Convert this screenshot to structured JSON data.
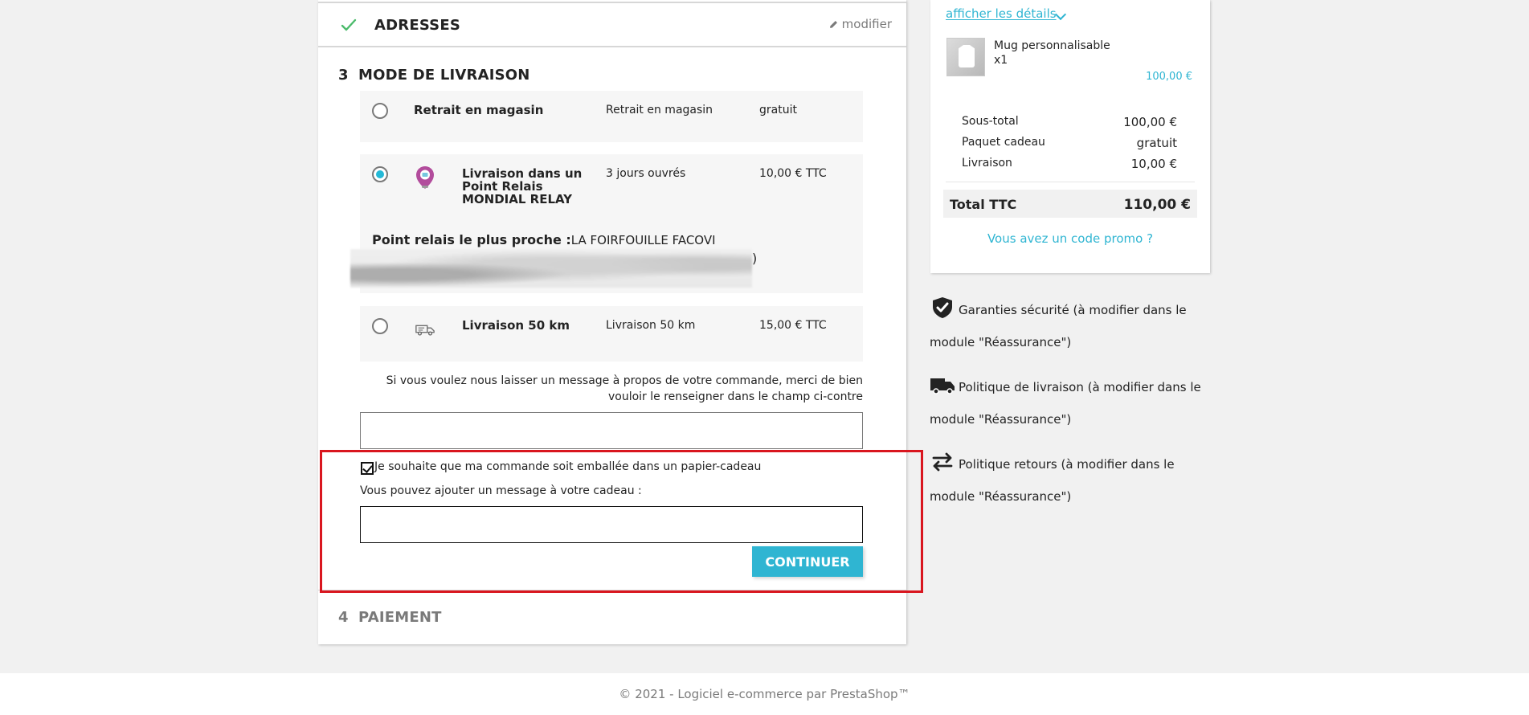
{
  "checkout": {
    "addresses": {
      "title": "ADRESSES",
      "edit_label": "modifier"
    },
    "delivery": {
      "step_number": "3",
      "title": "MODE DE LIVRAISON",
      "carriers": [
        {
          "name": "Retrait en magasin",
          "delay": "Retrait en magasin",
          "price": "gratuit",
          "selected": false
        },
        {
          "name": "Livraison dans un Point Relais MONDIAL RELAY",
          "delay": "3 jours ouvrés",
          "price": "10,00 € TTC",
          "selected": true,
          "icon": "map-pin-icon"
        },
        {
          "name": "Livraison 50 km",
          "delay": "Livraison 50 km",
          "price": "15,00 € TTC",
          "selected": false,
          "icon": "delivery-truck-icon"
        }
      ],
      "relay_label": "Point relais le plus proche :",
      "relay_value": "LA FOIRFOUILLE FACOVI",
      "relay_tail": ")",
      "message_intro": "Si vous voulez nous laisser un message à propos de votre commande, merci de bien vouloir le renseigner dans le champ ci-contre",
      "gift_wrap_label": "Je souhaite que ma commande soit emballée dans un papier-cadeau",
      "gift_message_label": "Vous pouvez ajouter un message à votre cadeau :",
      "continue_label": "CONTINUER"
    },
    "payment": {
      "step_number": "4",
      "title": "PAIEMENT"
    }
  },
  "summary": {
    "details_link": "afficher les détails",
    "product": {
      "name": "Mug personnalisable",
      "quantity": "x1",
      "price": "100,00 €"
    },
    "subtotal_label": "Sous-total",
    "subtotal_value": "100,00 €",
    "gift_label": "Paquet cadeau",
    "gift_value": "gratuit",
    "shipping_label": "Livraison",
    "shipping_value": "10,00 €",
    "total_label": "Total TTC",
    "total_value": "110,00 €",
    "promo_link": "Vous avez un code promo ?"
  },
  "reassurance": [
    {
      "icon": "shield-check-icon",
      "text": "Garanties sécurité (à modifier dans le module \"Réassurance\")"
    },
    {
      "icon": "truck-icon",
      "text": "Politique de livraison (à modifier dans le module \"Réassurance\")"
    },
    {
      "icon": "return-arrows-icon",
      "text": "Politique retours (à modifier dans le module \"Réassurance\")"
    }
  ],
  "footer": {
    "text": "© 2021 - Logiciel e-commerce par PrestaShop™"
  },
  "colors": {
    "accent": "#2fb5d2",
    "highlight": "#d9161f",
    "background": "#f1f1f1"
  }
}
